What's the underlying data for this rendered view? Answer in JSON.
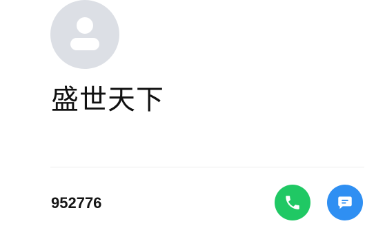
{
  "contact": {
    "name": "盛世天下",
    "phone": "952776"
  },
  "icons": {
    "avatar": "person-icon",
    "call": "phone-icon",
    "message": "message-icon"
  },
  "colors": {
    "avatar_bg": "#dcdfe5",
    "avatar_glyph": "#ffffff",
    "call_button": "#20c864",
    "message_button": "#2f8ff2",
    "divider": "#ececec"
  }
}
